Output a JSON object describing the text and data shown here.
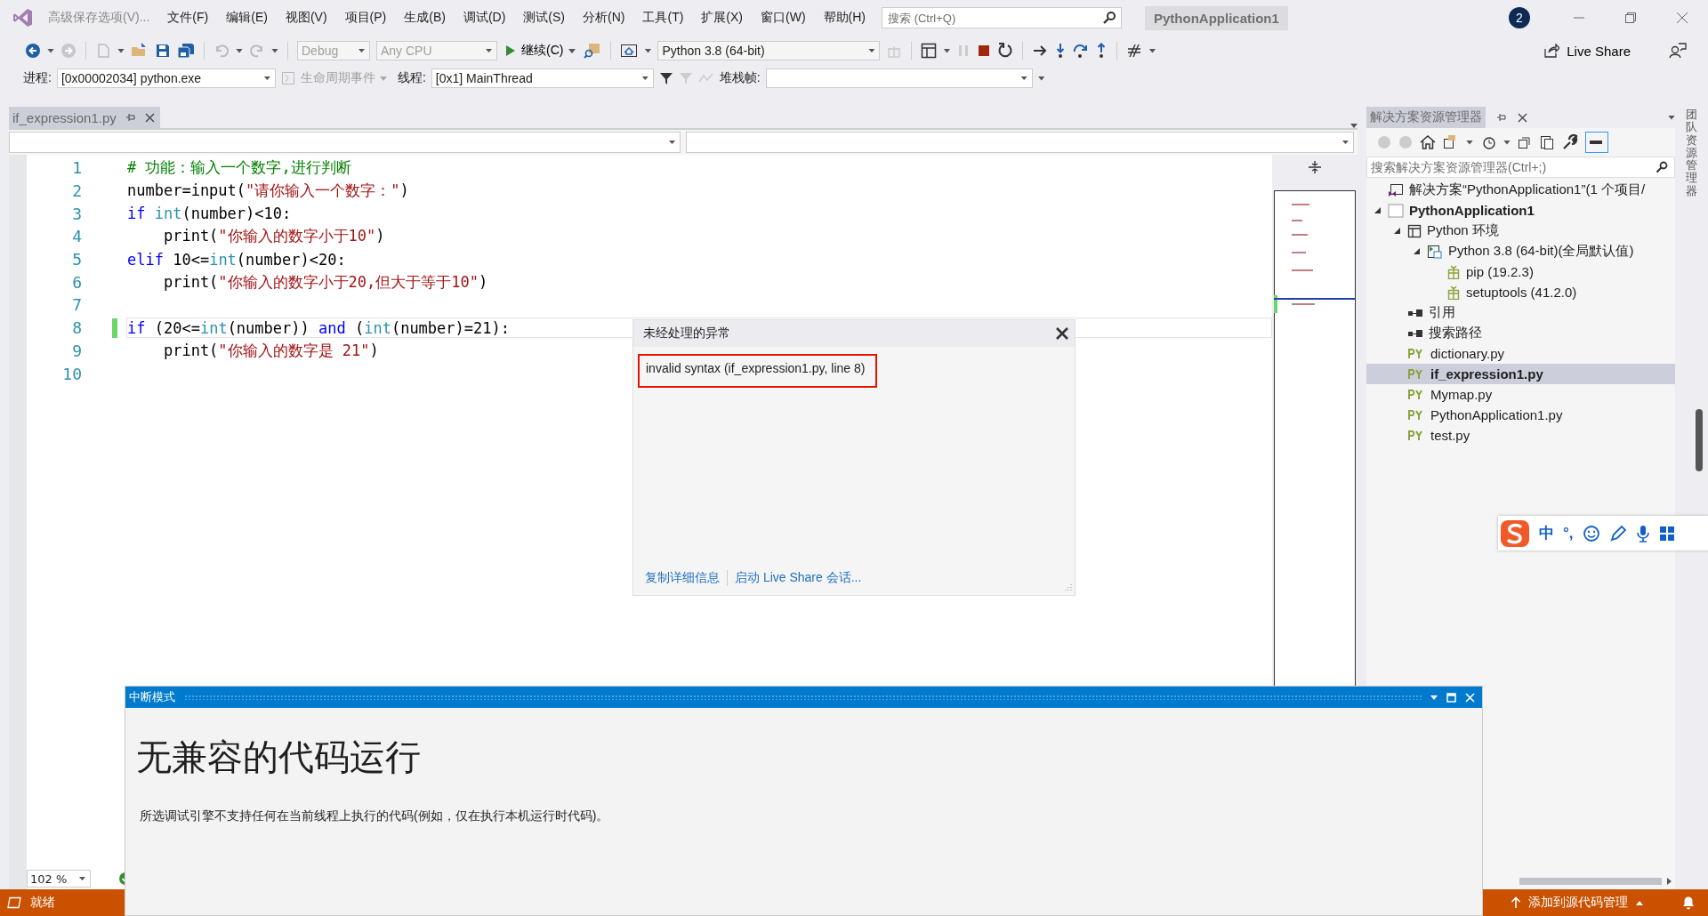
{
  "title_bar": {
    "menu": [
      {
        "label": "高级保存选项(V)...",
        "disabled": true
      },
      {
        "label": "文件(F)",
        "disabled": false
      },
      {
        "label": "编辑(E)",
        "disabled": false
      },
      {
        "label": "视图(V)",
        "disabled": false
      },
      {
        "label": "项目(P)",
        "disabled": false
      },
      {
        "label": "生成(B)",
        "disabled": false
      },
      {
        "label": "调试(D)",
        "disabled": false
      },
      {
        "label": "测试(S)",
        "disabled": false
      },
      {
        "label": "分析(N)",
        "disabled": false
      },
      {
        "label": "工具(T)",
        "disabled": false
      },
      {
        "label": "扩展(X)",
        "disabled": false
      },
      {
        "label": "窗口(W)",
        "disabled": false
      },
      {
        "label": "帮助(H)",
        "disabled": false
      }
    ],
    "search": {
      "placeholder": "搜索 (Ctrl+Q)"
    },
    "solution_name": "PythonApplication1",
    "notification_count": "2"
  },
  "toolbar": {
    "configuration": "Debug",
    "platform": "Any CPU",
    "continue": "继续(C)",
    "environment": "Python 3.8 (64-bit)",
    "live_share": "Live Share"
  },
  "debug_location": {
    "process_label": "进程:",
    "process": "[0x00002034] python.exe",
    "lifecycle": "生命周期事件",
    "thread_label": "线程:",
    "thread": "[0x1] MainThread",
    "stack_label": "堆栈帧:"
  },
  "document_tab": {
    "title": "if_expression1.py"
  },
  "code_lines": [
    {
      "number": "1",
      "current": false,
      "modified": false,
      "tokens": [
        {
          "kind": "comment",
          "text": "# 功能：输入一个数字,进行判断"
        }
      ]
    },
    {
      "number": "2",
      "current": false,
      "modified": false,
      "tokens": [
        {
          "kind": "plain",
          "text": "number=input("
        },
        {
          "kind": "string",
          "text": "\"请你输入一个数字：\""
        },
        {
          "kind": "plain",
          "text": ")"
        }
      ]
    },
    {
      "number": "3",
      "current": false,
      "modified": false,
      "tokens": [
        {
          "kind": "keyword",
          "text": "if "
        },
        {
          "kind": "builtin",
          "text": "int"
        },
        {
          "kind": "plain",
          "text": "(number)<10:"
        }
      ]
    },
    {
      "number": "4",
      "current": false,
      "modified": false,
      "tokens": [
        {
          "kind": "plain",
          "text": "    print("
        },
        {
          "kind": "string",
          "text": "\"你输入的数字小于10\""
        },
        {
          "kind": "plain",
          "text": ")"
        }
      ]
    },
    {
      "number": "5",
      "current": false,
      "modified": false,
      "tokens": [
        {
          "kind": "keyword",
          "text": "elif"
        },
        {
          "kind": "plain",
          "text": " 10<="
        },
        {
          "kind": "builtin",
          "text": "int"
        },
        {
          "kind": "plain",
          "text": "(number)<20:"
        }
      ]
    },
    {
      "number": "6",
      "current": false,
      "modified": false,
      "tokens": [
        {
          "kind": "plain",
          "text": "    print("
        },
        {
          "kind": "string",
          "text": "\"你输入的数字小于20,但大于等于10\""
        },
        {
          "kind": "plain",
          "text": ")"
        }
      ]
    },
    {
      "number": "7",
      "current": false,
      "modified": false
    },
    {
      "number": "8",
      "current": true,
      "modified": true,
      "tokens": [
        {
          "kind": "keyword",
          "text": "if"
        },
        {
          "kind": "plain",
          "text": " (20<="
        },
        {
          "kind": "builtin",
          "text": "int"
        },
        {
          "kind": "plain",
          "text": "(number)) "
        },
        {
          "kind": "keyword",
          "text": "and"
        },
        {
          "kind": "plain",
          "text": " ("
        },
        {
          "kind": "builtin",
          "text": "int"
        },
        {
          "kind": "plain",
          "text": "(number)=21):"
        }
      ]
    },
    {
      "number": "9",
      "current": false,
      "modified": false,
      "tokens": [
        {
          "kind": "plain",
          "text": "    print("
        },
        {
          "kind": "string",
          "text": "\"你输入的数字是 21\""
        },
        {
          "kind": "plain",
          "text": ")"
        }
      ]
    },
    {
      "number": "10",
      "current": false,
      "modified": false
    }
  ],
  "exception": {
    "title": "未经处理的异常",
    "message": "invalid syntax (if_expression1.py, line 8)",
    "links": [
      "复制详细信息",
      "启动 Live Share 会话..."
    ]
  },
  "zoom": "102 %",
  "solution_explorer": {
    "title": "解决方案资源管理器",
    "search": {
      "placeholder": "搜索解决方案资源管理器(Ctrl+;)"
    },
    "tree": [
      {
        "label": "解决方案“PythonApplication1”(1 个项目/",
        "kind": "solution",
        "selected": false
      },
      {
        "label": "PythonApplication1",
        "kind": "project",
        "selected": false,
        "expanded": true,
        "children": [
          {
            "label": "Python 环境",
            "kind": "environments",
            "selected": false,
            "expanded": true,
            "children": [
              {
                "label": "Python 3.8 (64-bit)(全局默认值)",
                "kind": "interpreter",
                "selected": false,
                "expanded": true,
                "children": [
                  {
                    "label": "pip (19.2.3)",
                    "kind": "package",
                    "selected": false
                  },
                  {
                    "label": "setuptools (41.2.0)",
                    "kind": "package",
                    "selected": false
                  }
                ]
              }
            ]
          },
          {
            "label": "引用",
            "kind": "references",
            "selected": false
          },
          {
            "label": "搜索路径",
            "kind": "references",
            "selected": false
          },
          {
            "label": "dictionary.py",
            "kind": "file",
            "selected": false
          },
          {
            "label": "if_expression1.py",
            "kind": "file",
            "selected": true
          },
          {
            "label": "Mymap.py",
            "kind": "file",
            "selected": false
          },
          {
            "label": "PythonApplication1.py",
            "kind": "file",
            "selected": false
          },
          {
            "label": "test.py",
            "kind": "file",
            "selected": false
          }
        ]
      }
    ]
  },
  "side_tab": "团队资源管理器",
  "break_mode": {
    "title": "中断模式",
    "heading": "无兼容的代码运行",
    "message": "所选调试引擎不支持任何在当前线程上执行的代码(例如，仅在执行本机运行时代码)。"
  },
  "ime": {
    "mode": "中",
    "punctuation": "°,"
  },
  "status_bar": {
    "state": "就绪",
    "source_control": "添加到源代码管理"
  }
}
